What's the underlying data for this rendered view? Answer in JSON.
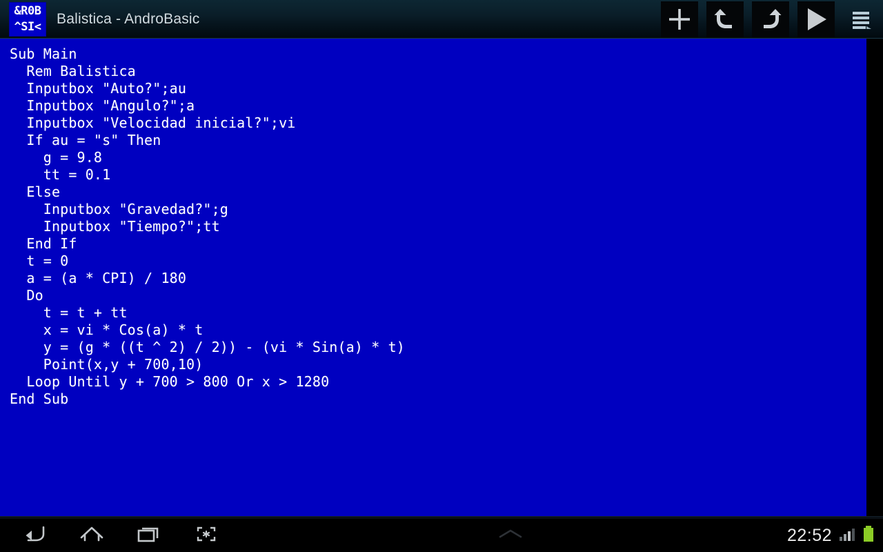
{
  "window": {
    "title": "Balistica - AndroBasic",
    "app_icon_line1": "&R0B",
    "app_icon_line2": "^SI<",
    "app_icon_bg": "#0000c8",
    "appbar_bg": "#0a1e29"
  },
  "toolbar": {
    "buttons": [
      {
        "name": "new-file-button",
        "icon": "plus-icon",
        "label": "New"
      },
      {
        "name": "undo-button",
        "icon": "undo-icon",
        "label": "Undo"
      },
      {
        "name": "redo-button",
        "icon": "redo-icon",
        "label": "Redo"
      },
      {
        "name": "run-button",
        "icon": "play-icon",
        "label": "Run"
      },
      {
        "name": "overflow-menu-button",
        "icon": "hamburger-menu-icon",
        "label": "Menu"
      }
    ]
  },
  "editor": {
    "background": "#0000c0",
    "foreground": "#ffffff",
    "language": "AndroBasic",
    "code": "Sub Main\n  Rem Balistica\n  Inputbox \"Auto?\";au\n  Inputbox \"Angulo?\";a\n  Inputbox \"Velocidad inicial?\";vi\n  If au = \"s\" Then\n    g = 9.8\n    tt = 0.1\n  Else\n    Inputbox \"Gravedad?\";g\n    Inputbox \"Tiempo?\";tt\n  End If\n  t = 0\n  a = (a * CPI) / 180\n  Do\n    t = t + tt\n    x = vi * Cos(a) * t\n    y = (g * ((t ^ 2) / 2)) - (vi * Sin(a) * t)\n    Point(x,y + 700,10)\n  Loop Until y + 700 > 800 Or x > 1280\nEnd Sub",
    "lines": [
      "Sub Main",
      "  Rem Balistica",
      "  Inputbox \"Auto?\";au",
      "  Inputbox \"Angulo?\";a",
      "  Inputbox \"Velocidad inicial?\";vi",
      "  If au = \"s\" Then",
      "    g = 9.8",
      "    tt = 0.1",
      "  Else",
      "    Inputbox \"Gravedad?\";g",
      "    Inputbox \"Tiempo?\";tt",
      "  End If",
      "  t = 0",
      "  a = (a * CPI) / 180",
      "  Do",
      "    t = t + tt",
      "    x = vi * Cos(a) * t",
      "    y = (g * ((t ^ 2) / 2)) - (vi * Sin(a) * t)",
      "    Point(x,y + 700,10)",
      "  Loop Until y + 700 > 800 Or x > 1280",
      "End Sub"
    ]
  },
  "navbar": {
    "buttons": [
      {
        "name": "nav-back-button",
        "icon": "back-arrow-icon",
        "label": "Back"
      },
      {
        "name": "nav-home-button",
        "icon": "home-icon",
        "label": "Home"
      },
      {
        "name": "nav-recents-button",
        "icon": "recents-icon",
        "label": "Recent apps"
      },
      {
        "name": "nav-screenshot-button",
        "icon": "screenshot-icon",
        "label": "Screenshot"
      }
    ],
    "expand_handle_icon": "chevron-up-icon",
    "clock": "22:52",
    "signal_icon": "signal-bars-icon",
    "battery_icon": "battery-full-icon",
    "battery_color": "#8ccc26"
  }
}
